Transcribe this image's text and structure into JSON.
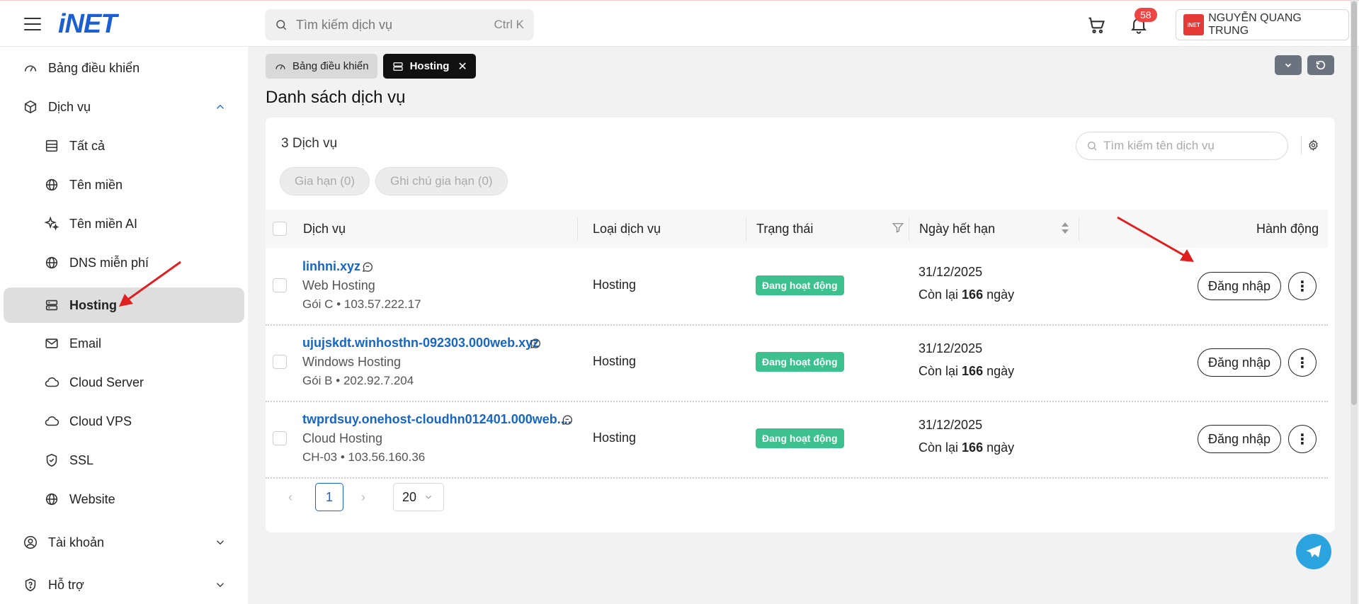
{
  "header": {
    "logo": "iNET",
    "search_placeholder": "Tìm kiếm dịch vụ",
    "search_shortcut": "Ctrl K",
    "notification_count": "58",
    "user_avatar_text": "iNET",
    "user_name": "NGUYỄN QUANG TRUNG"
  },
  "sidebar": {
    "items": [
      {
        "label": "Bảng điều khiển"
      },
      {
        "label": "Dịch vụ"
      },
      {
        "label": "Tất cả"
      },
      {
        "label": "Tên miền"
      },
      {
        "label": "Tên miền AI"
      },
      {
        "label": "DNS miễn phí"
      },
      {
        "label": "Hosting"
      },
      {
        "label": "Email"
      },
      {
        "label": "Cloud Server"
      },
      {
        "label": "Cloud VPS"
      },
      {
        "label": "SSL"
      },
      {
        "label": "Website"
      },
      {
        "label": "Tài khoản"
      },
      {
        "label": "Hỗ trợ"
      }
    ]
  },
  "tabs": [
    {
      "label": "Bảng điều khiển"
    },
    {
      "label": "Hosting"
    }
  ],
  "page_title": "Danh sách dịch vụ",
  "card": {
    "count": "3 Dịch vụ",
    "search_placeholder": "Tìm kiếm tên dịch vụ",
    "filters": [
      "Gia hạn (0)",
      "Ghi chú gia hạn (0)"
    ]
  },
  "table": {
    "headers": {
      "service": "Dịch vụ",
      "type": "Loại dịch vụ",
      "status": "Trạng thái",
      "expiry": "Ngày hết hạn",
      "action": "Hành động"
    },
    "rows": [
      {
        "name": "linhni.xyz",
        "sub_type": "Web Hosting",
        "plan": "Gói C",
        "ip": "103.57.222.17",
        "kind": "Hosting",
        "status": "Đang hoạt động",
        "expiry": "31/12/2025",
        "remain_prefix": "Còn lại",
        "remain_days": "166",
        "remain_suffix": "ngày",
        "login": "Đăng nhập"
      },
      {
        "name": "ujujskdt.winhosthn-092303.000web.xyz",
        "sub_type": "Windows Hosting",
        "plan": "Gói B",
        "ip": "202.92.7.204",
        "kind": "Hosting",
        "status": "Đang hoạt động",
        "expiry": "31/12/2025",
        "remain_prefix": "Còn lại",
        "remain_days": "166",
        "remain_suffix": "ngày",
        "login": "Đăng nhập"
      },
      {
        "name": "twprdsuy.onehost-cloudhn012401.000web....",
        "sub_type": "Cloud Hosting",
        "plan": "CH-03",
        "ip": "103.56.160.36",
        "kind": "Hosting",
        "status": "Đang hoạt động",
        "expiry": "31/12/2025",
        "remain_prefix": "Còn lại",
        "remain_days": "166",
        "remain_suffix": "ngày",
        "login": "Đăng nhập"
      }
    ]
  },
  "pagination": {
    "current_page": "1",
    "page_size": "20"
  },
  "colors": {
    "brand": "#1a5fd1",
    "link": "#1766c2",
    "status_active": "#3cc08d",
    "badge": "#ef4444",
    "annotation_arrow": "#e02020"
  }
}
